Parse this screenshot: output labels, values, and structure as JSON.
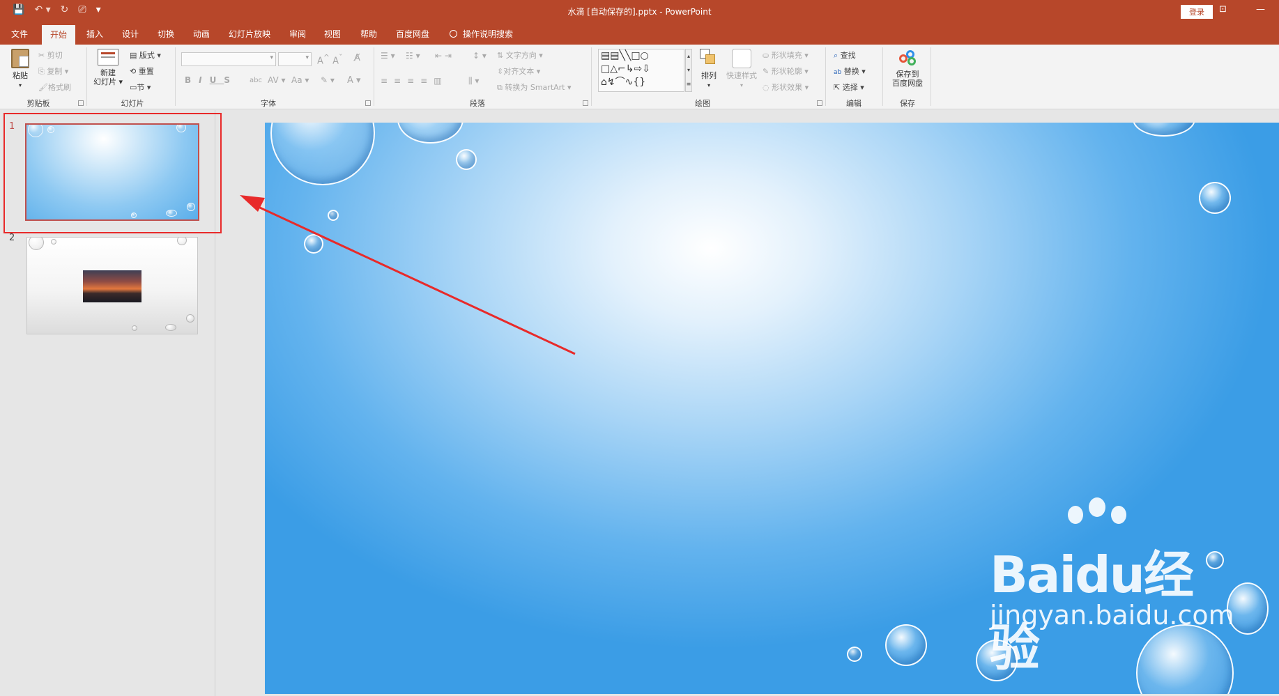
{
  "window": {
    "title": "水滴 [自动保存的].pptx  -  PowerPoint",
    "login_label": "登录"
  },
  "tabs": [
    {
      "label": "文件"
    },
    {
      "label": "开始"
    },
    {
      "label": "插入"
    },
    {
      "label": "设计"
    },
    {
      "label": "切换"
    },
    {
      "label": "动画"
    },
    {
      "label": "幻灯片放映"
    },
    {
      "label": "审阅"
    },
    {
      "label": "视图"
    },
    {
      "label": "帮助"
    },
    {
      "label": "百度网盘"
    }
  ],
  "tell_me": "操作说明搜索",
  "ribbon": {
    "clipboard": {
      "label": "剪贴板",
      "paste": "粘贴",
      "cut": "剪切",
      "copy": "复制",
      "format_painter": "格式刷"
    },
    "slides": {
      "label": "幻灯片",
      "new_slide_1": "新建",
      "new_slide_2": "幻灯片",
      "layout": "版式",
      "reset": "重置",
      "section": "节"
    },
    "font": {
      "label": "字体"
    },
    "paragraph": {
      "label": "段落",
      "text_direction": "文字方向",
      "align_text": "对齐文本",
      "smartart": "转换为 SmartArt"
    },
    "drawing": {
      "label": "绘图",
      "arrange": "排列",
      "quick_styles": "快速样式",
      "shape_fill": "形状填充",
      "shape_outline": "形状轮廓",
      "shape_effects": "形状效果"
    },
    "editing": {
      "label": "编辑",
      "find": "查找",
      "replace": "替换",
      "select": "选择"
    },
    "save": {
      "label": "保存",
      "save_to_1": "保存到",
      "save_to_2": "百度网盘"
    }
  },
  "thumbnails": [
    {
      "number": "1"
    },
    {
      "number": "2"
    }
  ],
  "watermark": {
    "brand": "Baidu经验",
    "url": "jingyan.baidu.com"
  },
  "colors": {
    "accent": "#b7472a",
    "highlight": "#e82a2a"
  }
}
